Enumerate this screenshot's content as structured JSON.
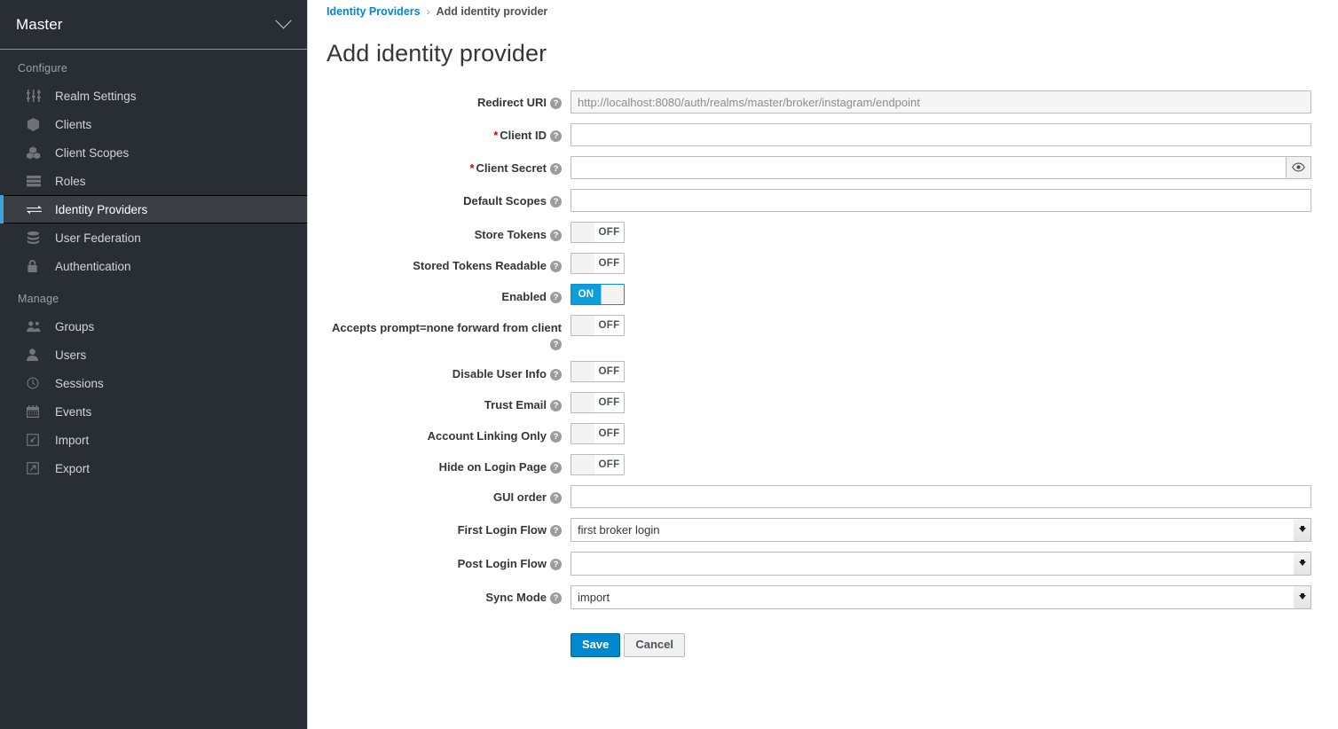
{
  "sidebar": {
    "realm": {
      "label": "Master",
      "icon": "chevron-down-icon"
    },
    "groups": [
      {
        "title": "Configure",
        "items": [
          {
            "label": "Realm Settings",
            "icon": "sliders-icon",
            "active": false
          },
          {
            "label": "Clients",
            "icon": "cube-icon",
            "active": false
          },
          {
            "label": "Client Scopes",
            "icon": "cubes-icon",
            "active": false
          },
          {
            "label": "Roles",
            "icon": "server-list-icon",
            "active": false
          },
          {
            "label": "Identity Providers",
            "icon": "exchange-arrows-icon",
            "active": true
          },
          {
            "label": "User Federation",
            "icon": "database-icon",
            "active": false
          },
          {
            "label": "Authentication",
            "icon": "lock-icon",
            "active": false
          }
        ]
      },
      {
        "title": "Manage",
        "items": [
          {
            "label": "Groups",
            "icon": "users-group-icon",
            "active": false
          },
          {
            "label": "Users",
            "icon": "user-icon",
            "active": false
          },
          {
            "label": "Sessions",
            "icon": "clock-icon",
            "active": false
          },
          {
            "label": "Events",
            "icon": "calendar-icon",
            "active": false
          },
          {
            "label": "Import",
            "icon": "import-arrow-icon",
            "active": false
          },
          {
            "label": "Export",
            "icon": "export-arrow-icon",
            "active": false
          }
        ]
      }
    ]
  },
  "breadcrumb": {
    "parent": "Identity Providers",
    "separator": "›",
    "current": "Add identity provider"
  },
  "page": {
    "title": "Add identity provider"
  },
  "form": {
    "redirect_uri": {
      "label": "Redirect URI",
      "value": "http://localhost:8080/auth/realms/master/broker/instagram/endpoint",
      "readonly": true
    },
    "client_id": {
      "label": "Client ID",
      "required": true,
      "value": ""
    },
    "client_secret": {
      "label": "Client Secret",
      "required": true,
      "value": "",
      "addon_icon": "eye-icon"
    },
    "default_scopes": {
      "label": "Default Scopes",
      "value": ""
    },
    "store_tokens": {
      "label": "Store Tokens",
      "state": "OFF"
    },
    "stored_tokens_readable": {
      "label": "Stored Tokens Readable",
      "state": "OFF"
    },
    "enabled": {
      "label": "Enabled",
      "state": "ON"
    },
    "accepts_prompt_none": {
      "label": "Accepts prompt=none forward from client",
      "state": "OFF"
    },
    "disable_user_info": {
      "label": "Disable User Info",
      "state": "OFF"
    },
    "trust_email": {
      "label": "Trust Email",
      "state": "OFF"
    },
    "account_linking_only": {
      "label": "Account Linking Only",
      "state": "OFF"
    },
    "hide_on_login_page": {
      "label": "Hide on Login Page",
      "state": "OFF"
    },
    "gui_order": {
      "label": "GUI order",
      "value": ""
    },
    "first_login_flow": {
      "label": "First Login Flow",
      "value": "first broker login",
      "options": [
        "first broker login"
      ]
    },
    "post_login_flow": {
      "label": "Post Login Flow",
      "value": "",
      "options": [
        ""
      ]
    },
    "sync_mode": {
      "label": "Sync Mode",
      "value": "import",
      "options": [
        "import"
      ]
    },
    "help_icon": "?",
    "required_marker": "*"
  },
  "buttons": {
    "save": "Save",
    "cancel": "Cancel"
  },
  "colors": {
    "accent": "#0088ce",
    "toggle_on": "#0d9ddb",
    "sidebar_bg": "#292e34",
    "sidebar_active_bg": "#393f44",
    "required": "#cc0000"
  }
}
